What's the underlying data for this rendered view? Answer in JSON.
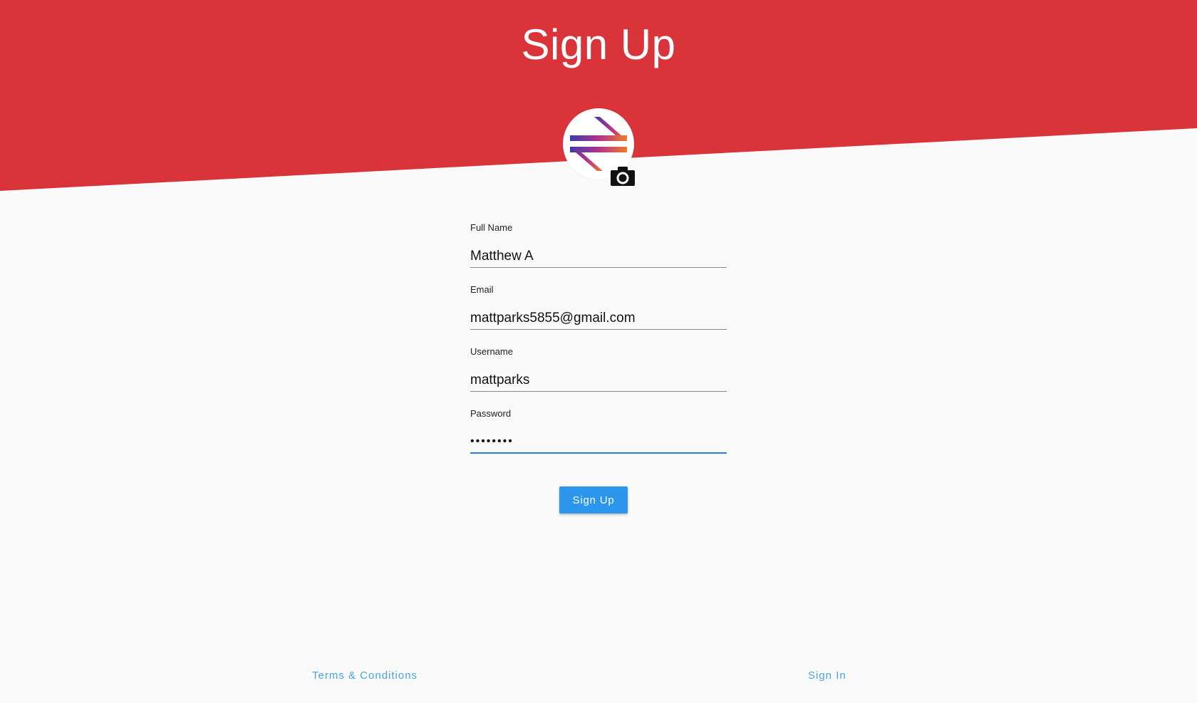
{
  "colors": {
    "header_red": "#d8343a",
    "background": "#fafafa",
    "primary_blue": "#2b96ec",
    "link_blue": "#4aa3e0",
    "focus_underline": "#2a7fd4"
  },
  "header": {
    "title": "Sign Up"
  },
  "avatar": {
    "image_icon": "swap-arrows-logo",
    "upload_icon": "camera-icon"
  },
  "form": {
    "full_name": {
      "label": "Full Name",
      "value": "Matthew A"
    },
    "email": {
      "label": "Email",
      "value": "mattparks5855@gmail.com"
    },
    "username": {
      "label": "Username",
      "value": "mattparks"
    },
    "password": {
      "label": "Password",
      "value": "••••••••",
      "focused": true
    },
    "submit_label": "Sign Up"
  },
  "footer": {
    "terms_label": "Terms & Conditions",
    "signin_label": "Sign In"
  }
}
